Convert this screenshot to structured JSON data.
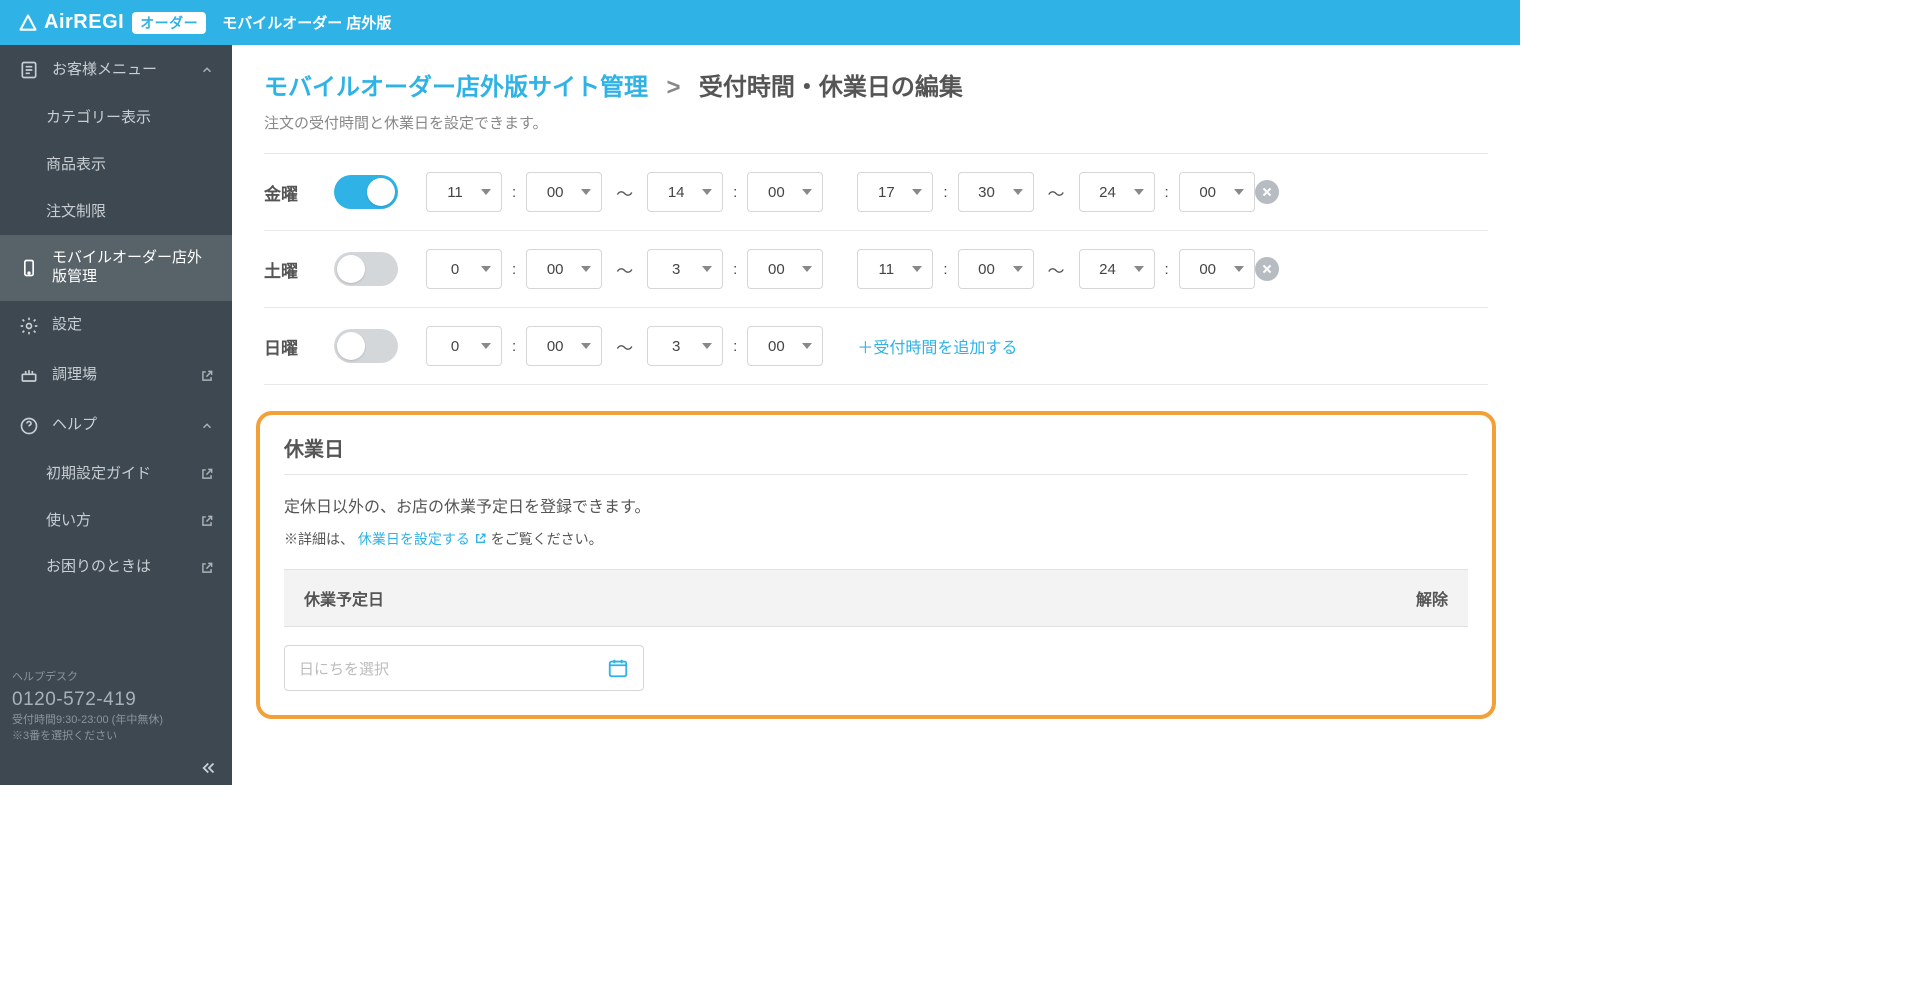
{
  "header": {
    "brand_main": "AirREGI",
    "brand_badge": "オーダー",
    "sub": "モバイルオーダー 店外版"
  },
  "sidebar": {
    "group_customer": "お客様メニュー",
    "item_category": "カテゴリー表示",
    "item_product": "商品表示",
    "item_order_limit": "注文制限",
    "item_mo_manage": "モバイルオーダー店外版管理",
    "item_settings": "設定",
    "item_kitchen": "調理場",
    "group_help": "ヘルプ",
    "item_setup_guide": "初期設定ガイド",
    "item_howto": "使い方",
    "item_trouble": "お困りのときは"
  },
  "helpdesk": {
    "label": "ヘルプデスク",
    "tel": "0120-572-419",
    "hours": "受付時間9:30-23:00 (年中無休)",
    "note": "※3番を選択ください"
  },
  "breadcrumb": {
    "root": "モバイルオーダー店外版サイト管理",
    "sep": ">",
    "leaf": "受付時間・休業日の編集",
    "desc": "注文の受付時間と休業日を設定できます。"
  },
  "rows": [
    {
      "day": "金曜",
      "on": true,
      "s1h": "11",
      "s1m": "00",
      "e1h": "14",
      "e1m": "00",
      "s2h": "17",
      "s2m": "30",
      "e2h": "24",
      "e2m": "00",
      "has2": true
    },
    {
      "day": "土曜",
      "on": false,
      "s1h": "0",
      "s1m": "00",
      "e1h": "3",
      "e1m": "00",
      "s2h": "11",
      "s2m": "00",
      "e2h": "24",
      "e2m": "00",
      "has2": true
    },
    {
      "day": "日曜",
      "on": false,
      "s1h": "0",
      "s1m": "00",
      "e1h": "3",
      "e1m": "00",
      "has2": false
    }
  ],
  "add_link": "＋受付時間を追加する",
  "holiday": {
    "title": "休業日",
    "desc": "定休日以外の、お店の休業予定日を登録できます。",
    "note_prefix": "※詳細は、",
    "note_link": "休業日を設定する",
    "note_suffix": " をご覧ください。",
    "col1": "休業予定日",
    "col2": "解除",
    "placeholder": "日にちを選択"
  }
}
